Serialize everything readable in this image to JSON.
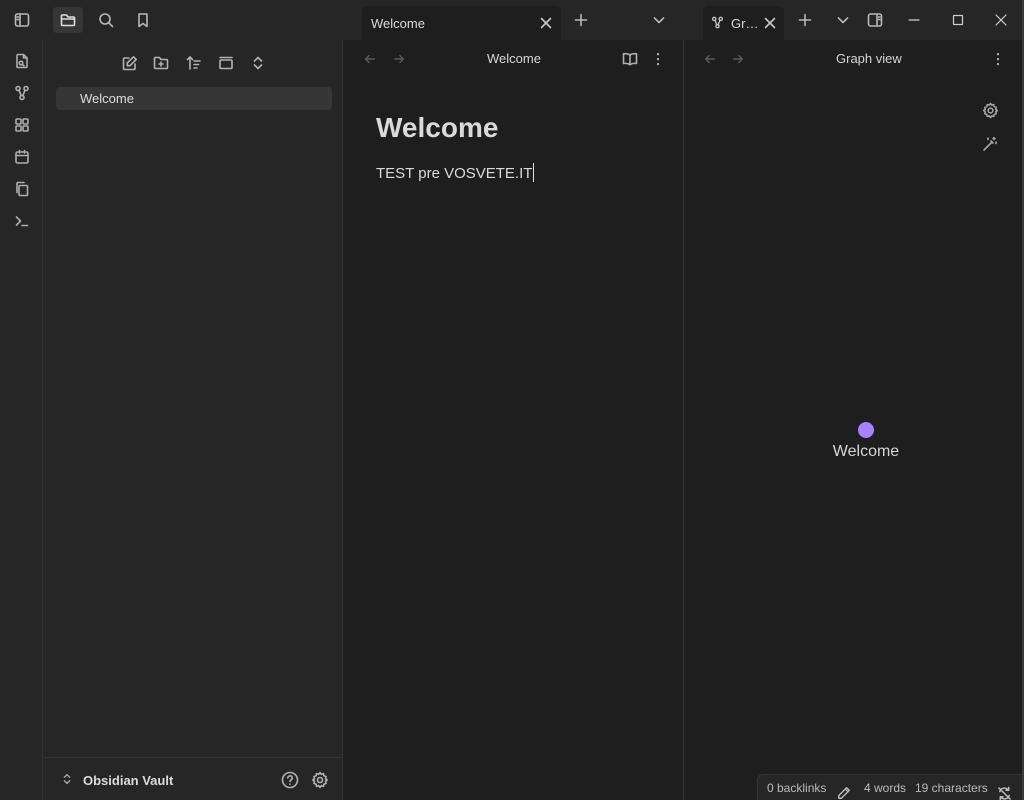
{
  "window": {
    "tabs": [
      {
        "label": "Welcome",
        "active": true
      },
      {
        "label": "Gr…",
        "icon": "graph-icon",
        "active": true
      }
    ],
    "icons": [
      "sidebar-toggle-icon",
      "folder-icon",
      "search-icon",
      "bookmark-icon",
      "plus-icon",
      "chevron-down-icon",
      "close-icon",
      "minimize-icon",
      "maximize-icon",
      "layout-icon"
    ]
  },
  "ribbon": {
    "items": [
      "open-quick-switcher-icon",
      "graph-icon",
      "canvas-icon",
      "calendar-icon",
      "copy-icon",
      "terminal-icon"
    ]
  },
  "sidebar": {
    "nav_actions": [
      "new-note-icon",
      "new-folder-icon",
      "sort-icon",
      "collapse-icon",
      "expand-icon"
    ],
    "files": [
      {
        "name": "Welcome",
        "selected": true
      }
    ],
    "vault_name": "Obsidian Vault"
  },
  "editor": {
    "header_title": "Welcome",
    "note_title": "Welcome",
    "note_body": "TEST pre VOSVETE.IT"
  },
  "graph": {
    "header_title": "Graph view",
    "nodes": [
      {
        "label": "Welcome",
        "color": "#a882ff"
      }
    ]
  },
  "status": {
    "backlinks": "0 backlinks",
    "words": "4 words",
    "characters": "19 characters",
    "sync_icon_color": "#e24a4a"
  },
  "colors": {
    "background": "#1e1e1e",
    "sidebar": "#262626",
    "accent": "#a882ff"
  }
}
